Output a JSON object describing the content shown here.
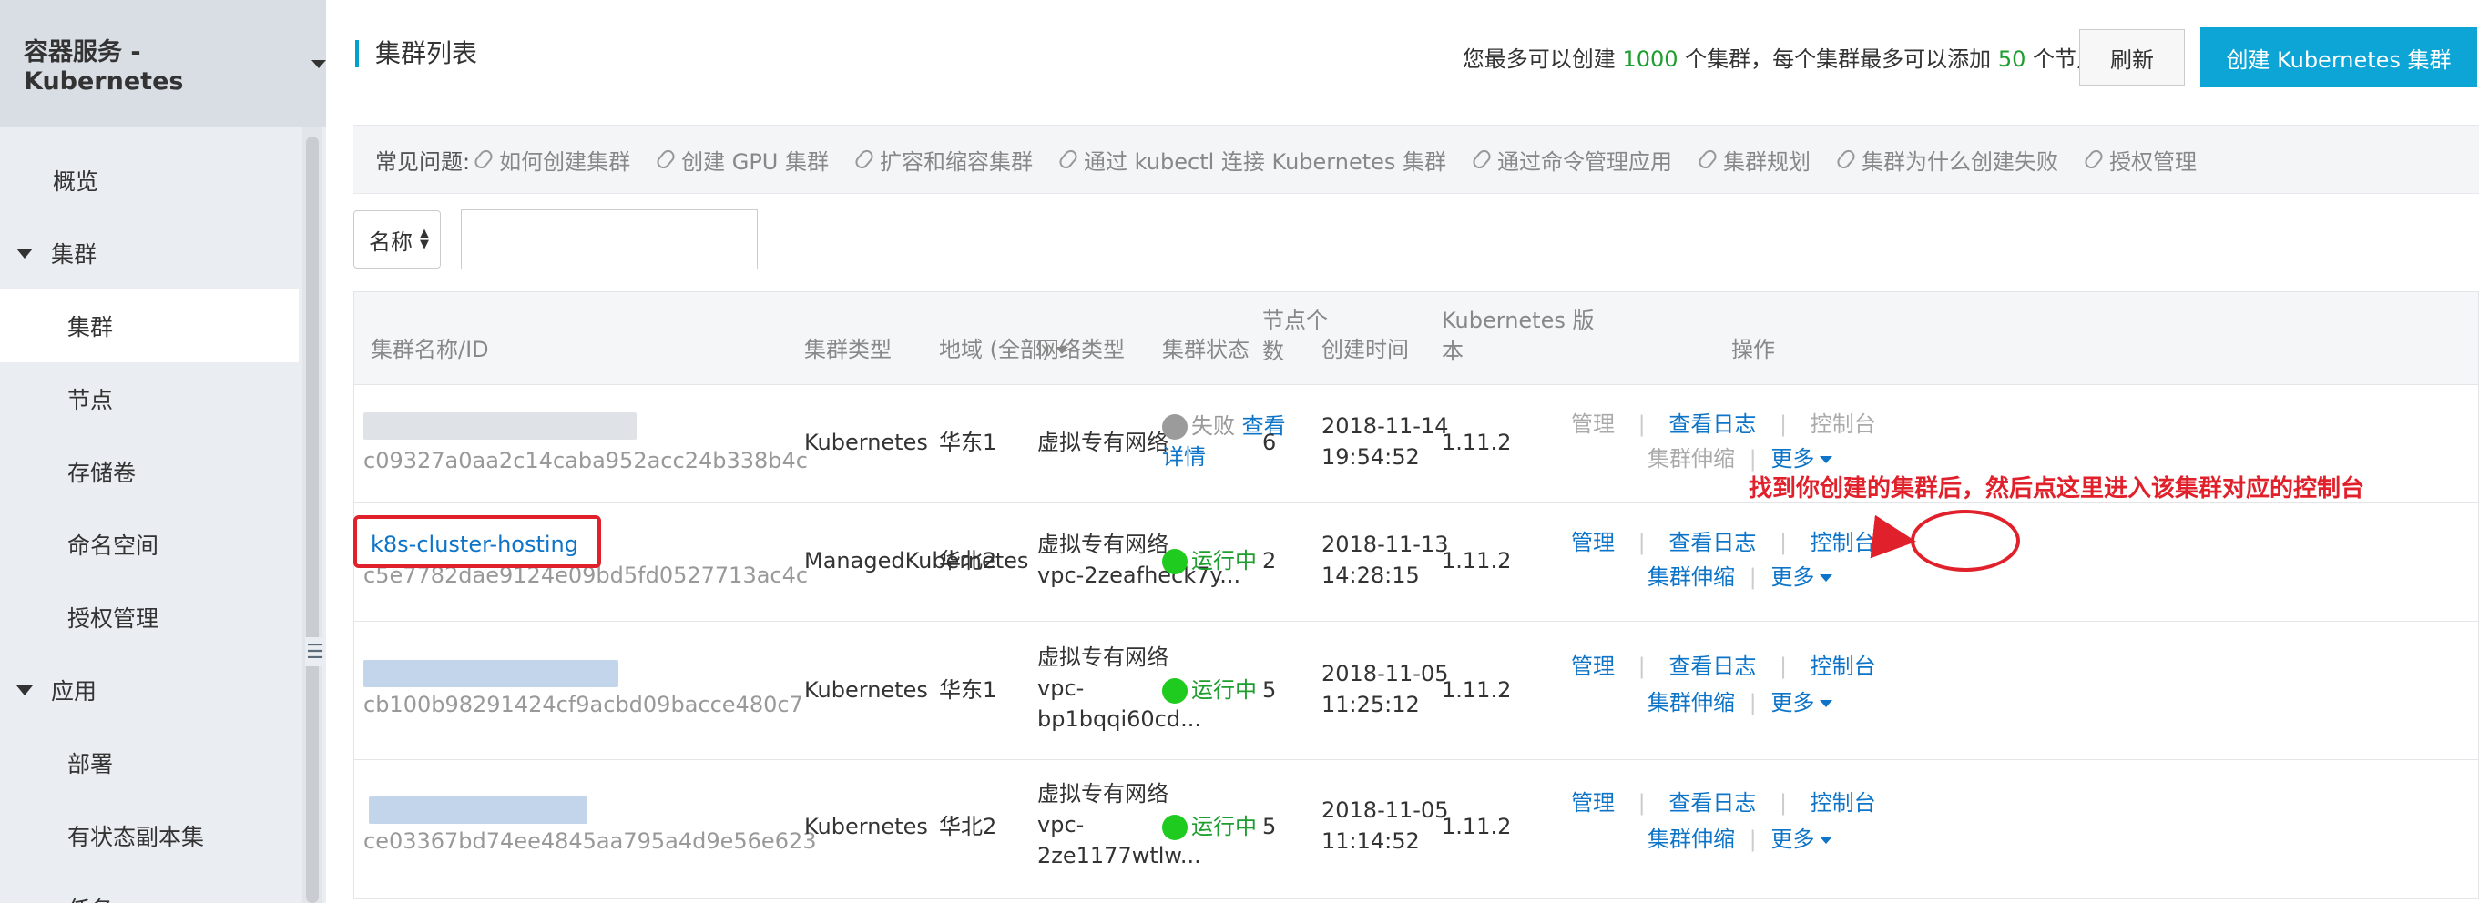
{
  "sidebar": {
    "title": "容器服务 - Kubernetes",
    "items": [
      {
        "label": "概览"
      },
      {
        "label": "集群"
      },
      {
        "label": "集群"
      },
      {
        "label": "节点"
      },
      {
        "label": "存储卷"
      },
      {
        "label": "命名空间"
      },
      {
        "label": "授权管理"
      },
      {
        "label": "应用"
      },
      {
        "label": "部署"
      },
      {
        "label": "有状态副本集"
      },
      {
        "label": "任务"
      }
    ]
  },
  "header": {
    "title": "集群列表",
    "quota_prefix": "您最多可以创建",
    "quota_clusters": "1000",
    "quota_middle": "个集群，每个集群最多可以添加",
    "quota_nodes": "50",
    "quota_suffix": "个节点",
    "refresh_label": "刷新",
    "create_label": "创建 Kubernetes 集群"
  },
  "faq": {
    "label": "常见问题:",
    "links": [
      "如何创建集群",
      "创建 GPU 集群",
      "扩容和缩容集群",
      "通过 kubectl 连接 Kubernetes 集群",
      "通过命令管理应用",
      "集群规划",
      "集群为什么创建失败",
      "授权管理"
    ]
  },
  "filter": {
    "select_value": "名称",
    "input_value": ""
  },
  "table": {
    "headers": {
      "name": "集群名称/ID",
      "type": "集群类型",
      "region": "地域 (全部)",
      "network": "网络类型",
      "status": "集群状态",
      "nodes_1": "节点个",
      "nodes_2": "数",
      "created": "创建时间",
      "version_1": "Kubernetes 版",
      "version_2": "本",
      "ops": "操作"
    },
    "rows": [
      {
        "name": "",
        "id": "c09327a0aa2c14caba952acc24b338b4c",
        "type": "Kubernetes",
        "region": "华东1",
        "network": "虚拟专有网络",
        "network_2": "",
        "network_3": "",
        "status": "失败",
        "status_link_1": "查看",
        "status_link_2": "详情",
        "nodes": "6",
        "created_date": "2018-11-14",
        "created_time": "19:54:52",
        "version": "1.11.2",
        "op_manage": "管理",
        "op_logs": "查看日志",
        "op_console": "控制台",
        "op_scale": "集群伸缩",
        "op_more": "更多"
      },
      {
        "name": "k8s-cluster-hosting",
        "id": "c5e7782dae9124e09bd5fd0527713ac4c",
        "type": "ManagedKubernetes",
        "region": "华北2",
        "network": "虚拟专有网络",
        "network_2": "vpc-2zeafheck7y...",
        "network_3": "",
        "status": "运行中",
        "nodes": "2",
        "created_date": "2018-11-13",
        "created_time": "14:28:15",
        "version": "1.11.2",
        "op_manage": "管理",
        "op_logs": "查看日志",
        "op_console": "控制台",
        "op_scale": "集群伸缩",
        "op_more": "更多"
      },
      {
        "name": "",
        "id": "cb100b98291424cf9acbd09bacce480c7",
        "type": "Kubernetes",
        "region": "华东1",
        "network": "虚拟专有网络",
        "network_2": "vpc-",
        "network_3": "bp1bqqi60cd...",
        "status": "运行中",
        "nodes": "5",
        "created_date": "2018-11-05",
        "created_time": "11:25:12",
        "version": "1.11.2",
        "op_manage": "管理",
        "op_logs": "查看日志",
        "op_console": "控制台",
        "op_scale": "集群伸缩",
        "op_more": "更多"
      },
      {
        "name": "",
        "id": "ce03367bd74ee4845aa795a4d9e56e623",
        "type": "Kubernetes",
        "region": "华北2",
        "network": "虚拟专有网络",
        "network_2": "vpc-",
        "network_3": "2ze1177wtlw...",
        "status": "运行中",
        "nodes": "5",
        "created_date": "2018-11-05",
        "created_time": "11:14:52",
        "version": "1.11.2",
        "op_manage": "管理",
        "op_logs": "查看日志",
        "op_console": "控制台",
        "op_scale": "集群伸缩",
        "op_more": "更多"
      }
    ]
  },
  "annotation": {
    "text": "找到你创建的集群后，然后点这里进入该集群对应的控制台"
  },
  "colors": {
    "accent": "#0da5d6",
    "link": "#0d74c8",
    "running": "#1e9e2e",
    "highlight": "#e0202a"
  }
}
